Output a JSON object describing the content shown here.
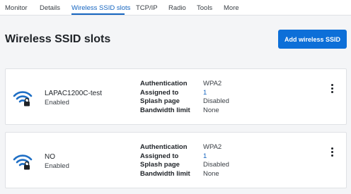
{
  "tabs": [
    {
      "label": "Monitor"
    },
    {
      "label": "Details"
    },
    {
      "label": "Wireless SSID slots"
    },
    {
      "label": "TCP/IP"
    },
    {
      "label": "Radio"
    },
    {
      "label": "Tools"
    },
    {
      "label": "More"
    }
  ],
  "active_tab": "Wireless SSID slots",
  "page": {
    "title": "Wireless SSID slots",
    "add_button_label": "Add wireless SSID"
  },
  "field_labels": {
    "authentication": "Authentication",
    "assigned_to": "Assigned to",
    "splash_page": "Splash page",
    "bandwidth_limit": "Bandwidth limit"
  },
  "ssids": [
    {
      "name": "LAPAC1200C-test",
      "status": "Enabled",
      "authentication": "WPA2",
      "assigned_to": "1",
      "splash_page": "Disabled",
      "bandwidth_limit": "None"
    },
    {
      "name": "NO",
      "status": "Enabled",
      "authentication": "WPA2",
      "assigned_to": "1",
      "splash_page": "Disabled",
      "bandwidth_limit": "None"
    }
  ],
  "icons": {
    "ssid": "wifi-lock-icon",
    "menu": "more-vertical-icon"
  },
  "colors": {
    "accent": "#1565c0",
    "button": "#0d6fd8",
    "icon": "#1f6fc5"
  }
}
